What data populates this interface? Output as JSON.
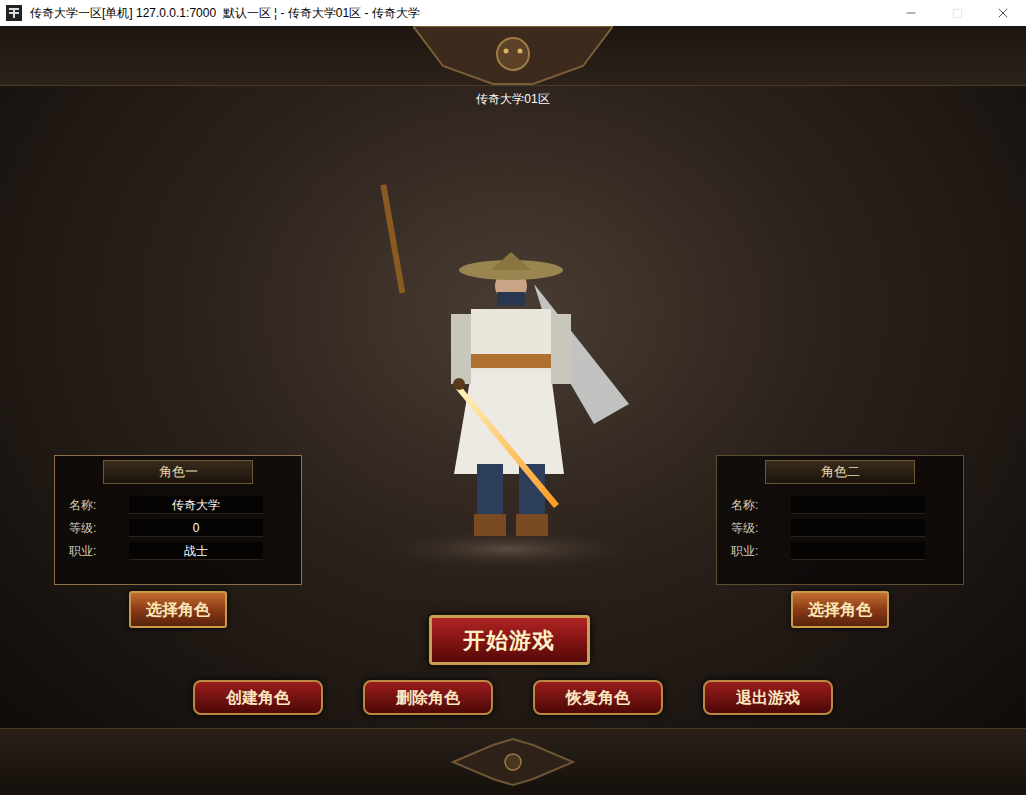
{
  "window": {
    "title": "传奇大学一区[单机] 127.0.0.1:7000  默认一区 ¦ - 传奇大学01区 - 传奇大学",
    "maximize_enabled": false
  },
  "server": "传奇大学01区",
  "characters": [
    {
      "header": "角色一",
      "selected": true,
      "select_button": "选择角色",
      "fields": [
        {
          "label": "名称:",
          "value": "传奇大学"
        },
        {
          "label": "等级:",
          "value": "0"
        },
        {
          "label": "职业:",
          "value": "战士"
        }
      ]
    },
    {
      "header": "角色二",
      "selected": false,
      "select_button": "选择角色",
      "fields": [
        {
          "label": "名称:",
          "value": ""
        },
        {
          "label": "等级:",
          "value": ""
        },
        {
          "label": "职业:",
          "value": ""
        }
      ]
    }
  ],
  "start_button": "开始游戏",
  "actions": [
    "创建角色",
    "删除角色",
    "恢复角色",
    "退出游戏"
  ]
}
